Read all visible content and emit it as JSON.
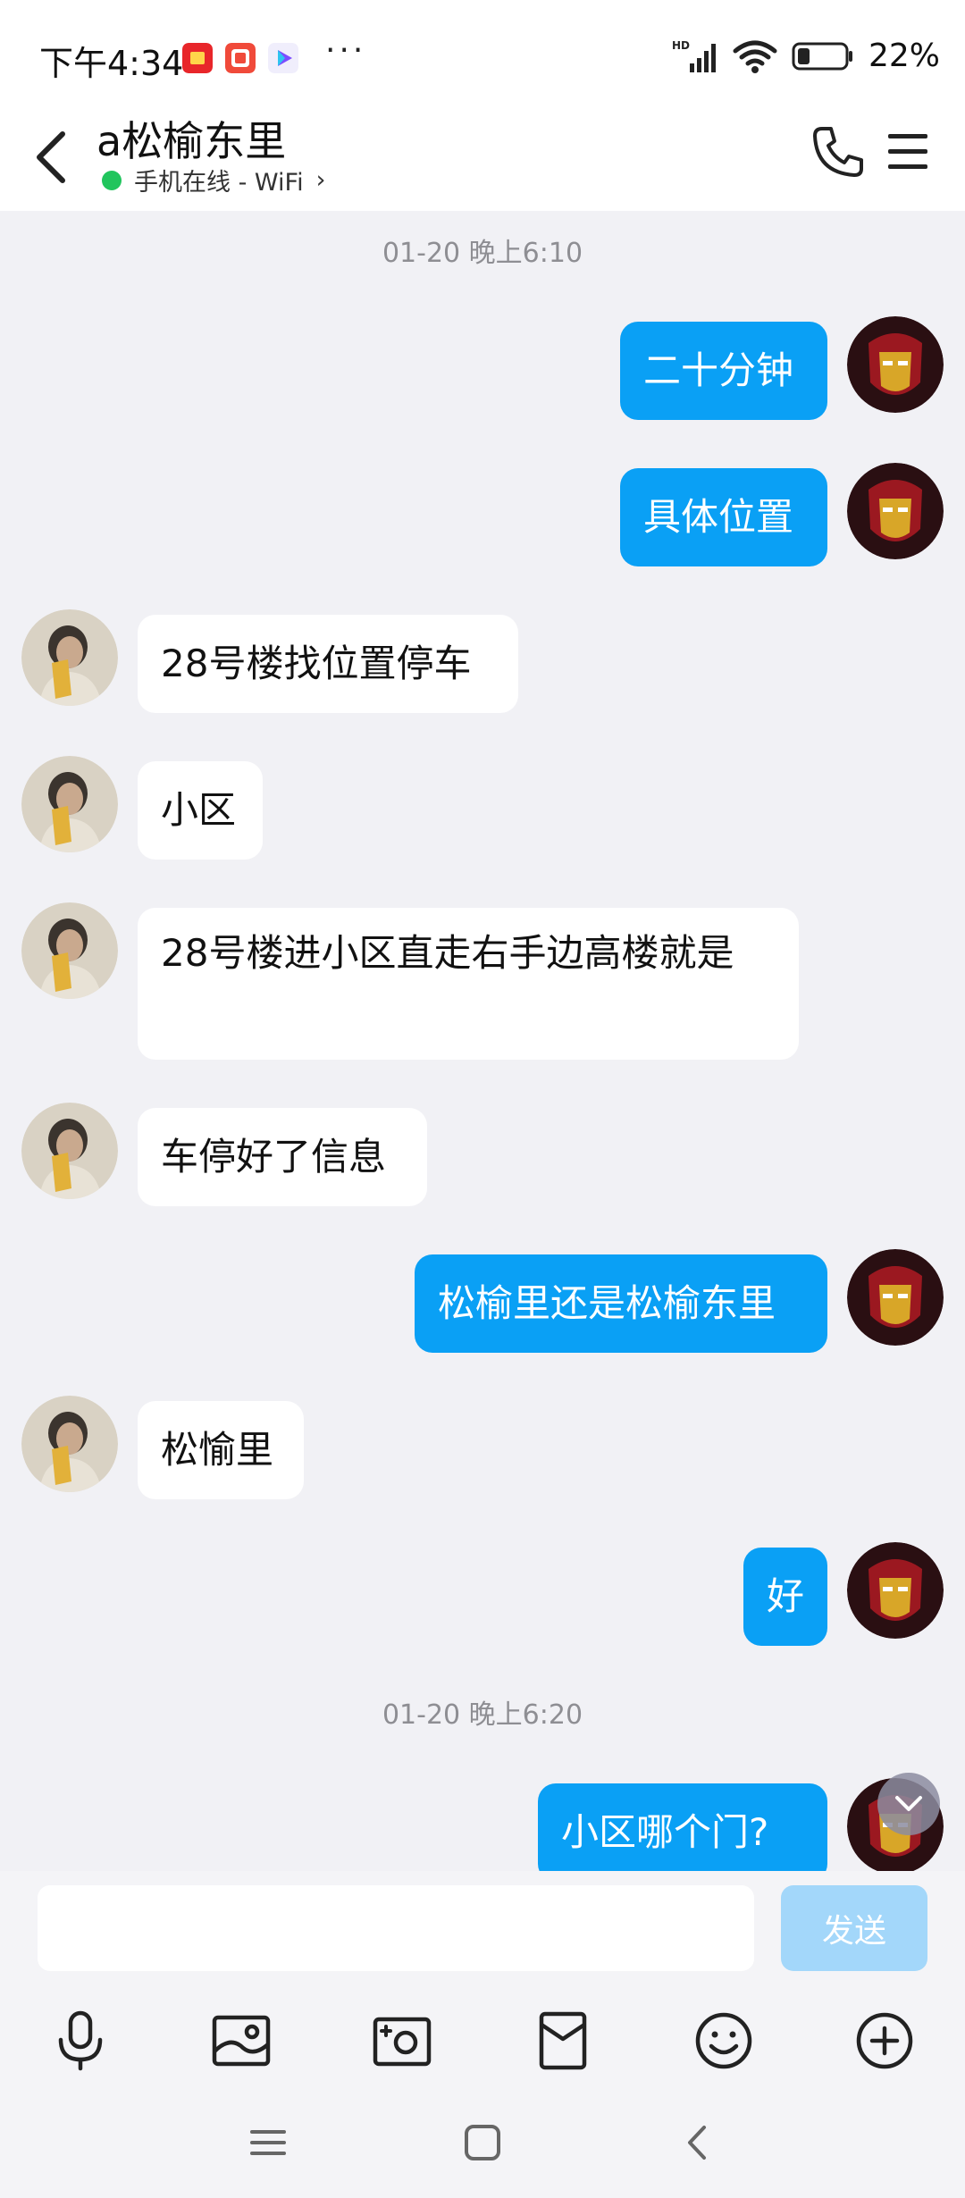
{
  "status_bar": {
    "time": "下午4:34",
    "battery": "22%",
    "app_icons": [
      "red-envelope-app-icon",
      "taobao-app-icon",
      "video-app-icon"
    ],
    "overflow": "···"
  },
  "header": {
    "title": "a松榆东里",
    "subtitle": "手机在线 - WiFi",
    "subtitle_chevron": "›"
  },
  "chat": {
    "timestamps": [
      "01-20 晚上6:10",
      "01-20 晚上6:20"
    ],
    "messages": [
      {
        "from": "me",
        "text": "二十分钟"
      },
      {
        "from": "me",
        "text": "具体位置"
      },
      {
        "from": "them",
        "text": "28号楼找位置停车"
      },
      {
        "from": "them",
        "text": "小区"
      },
      {
        "from": "them",
        "text": "28号楼进小区直走右手边高楼就是"
      },
      {
        "from": "them",
        "text": "车停好了信息"
      },
      {
        "from": "me",
        "text": "松榆里还是松榆东里"
      },
      {
        "from": "them",
        "text": "松愉里"
      },
      {
        "from": "me",
        "text": "好"
      },
      {
        "from": "me",
        "text": "小区哪个门?"
      }
    ]
  },
  "input": {
    "placeholder": "",
    "send_label": "发送"
  },
  "toolbar": [
    "microphone-icon",
    "image-icon",
    "camera-icon",
    "red-packet-icon",
    "emoji-icon",
    "plus-icon"
  ],
  "colors": {
    "my_bubble": "#0aa0f5",
    "their_bubble": "#ffffff",
    "background": "#f1f1f5",
    "online": "#21c55d",
    "send_disabled": "#a3d7fa"
  }
}
